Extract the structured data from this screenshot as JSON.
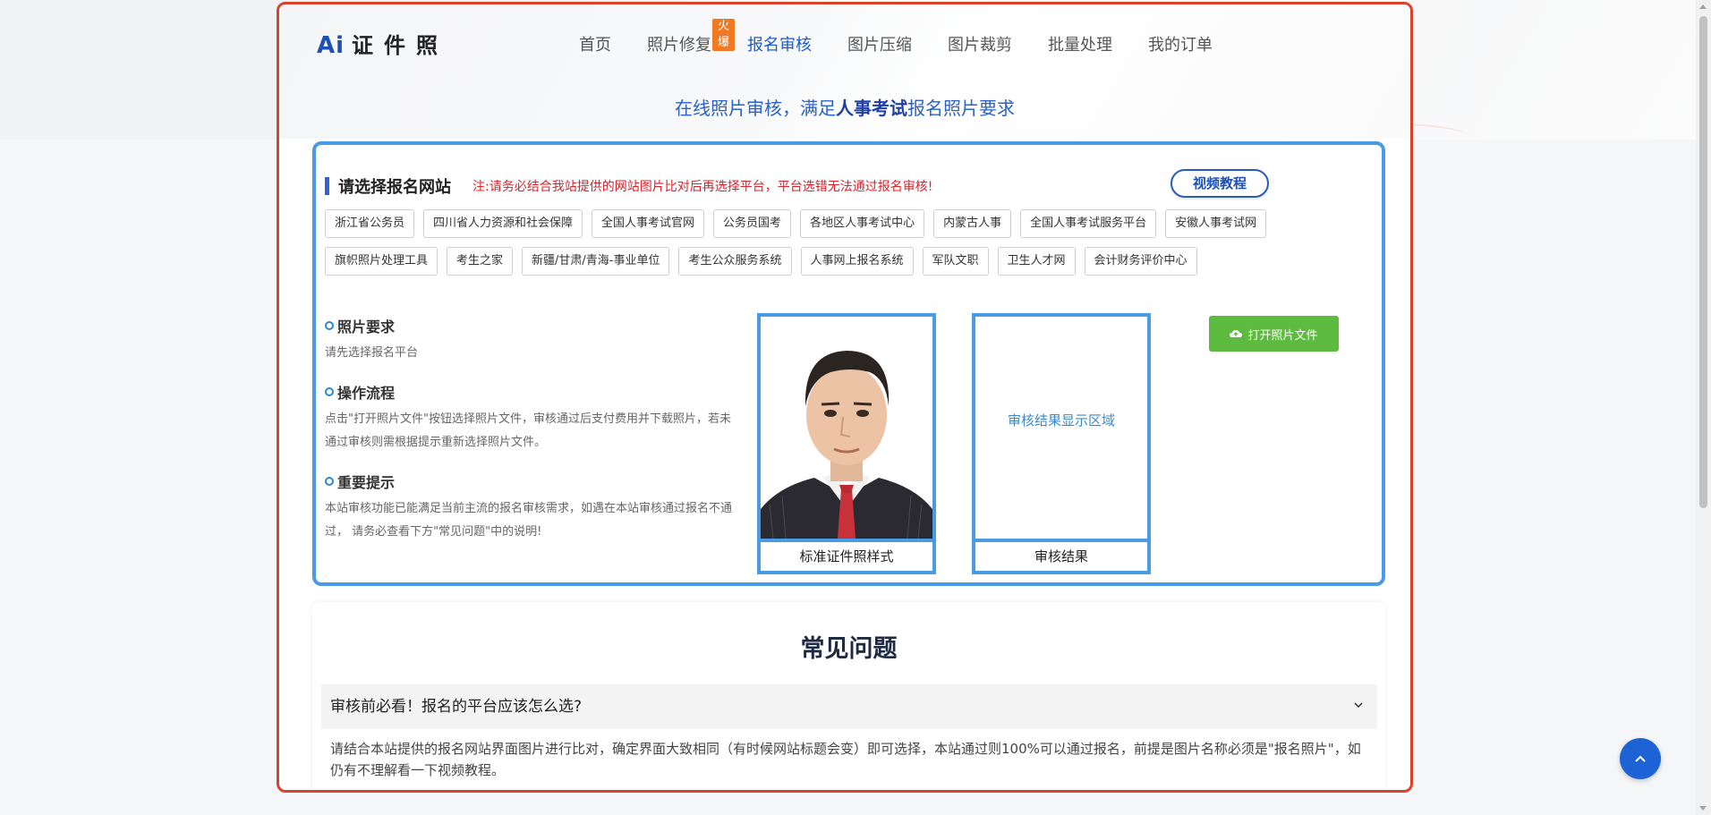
{
  "logo": {
    "ai": "Ai",
    "text": "证件照"
  },
  "nav": {
    "items": [
      {
        "label": "首页"
      },
      {
        "label": "照片修复",
        "badge": "火爆"
      },
      {
        "label": "报名审核"
      },
      {
        "label": "图片压缩"
      },
      {
        "label": "图片裁剪"
      },
      {
        "label": "批量处理"
      },
      {
        "label": "我的订单"
      }
    ],
    "active": "报名审核"
  },
  "subtitle": {
    "pre": "在线照片审核，满足",
    "bold": "人事考试",
    "post": "报名照片要求"
  },
  "select": {
    "title": "请选择报名网站",
    "note": "注:请务必结合我站提供的网站图片比对后再选择平台，平台选错无法通过报名审核!",
    "video_button": "视频教程",
    "platforms_row1": [
      "浙江省公务员",
      "四川省人力资源和社会保障",
      "全国人事考试官网",
      "公务员国考",
      "各地区人事考试中心",
      "内蒙古人事",
      "全国人事考试服务平台",
      "安徽人事考试网"
    ],
    "platforms_row2": [
      "旗帜照片处理工具",
      "考生之家",
      "新疆/甘肃/青海-事业单位",
      "考生公众服务系统",
      "人事网上报名系统",
      "军队文职",
      "卫生人才网",
      "会计财务评价中心"
    ]
  },
  "info": {
    "req_title": "照片要求",
    "req_text": "请先选择报名平台",
    "flow_title": "操作流程",
    "flow_text": "点击\"打开照片文件\"按钮选择照片文件，审核通过后支付费用并下载照片，若未通过审核则需根据提示重新选择照片文件。",
    "tip_title": "重要提示",
    "tip_text": "本站审核功能已能满足当前主流的报名审核需求，如遇在本站审核通过报名不通过， 请务必查看下方\"常见问题\"中的说明!"
  },
  "photos": {
    "sample_caption": "标准证件照样式",
    "result_placeholder": "审核结果显示区域",
    "result_caption": "审核结果"
  },
  "open_button": "打开照片文件",
  "faq": {
    "title": "常见问题",
    "question": "审核前必看！报名的平台应该怎么选?",
    "answer": "请结合本站提供的报名网站界面图片进行比对，确定界面大致相同（有时候网站标题会变）即可选择，本站通过则100%可以通过报名，前提是图片名称必须是\"报名照片\"，如仍有不理解看一下视频教程。"
  },
  "colors": {
    "accent": "#1e5bc7",
    "frame": "#d9432e",
    "box": "#4a9be6",
    "green": "#5dbb3f",
    "badge": "#f07a23"
  }
}
